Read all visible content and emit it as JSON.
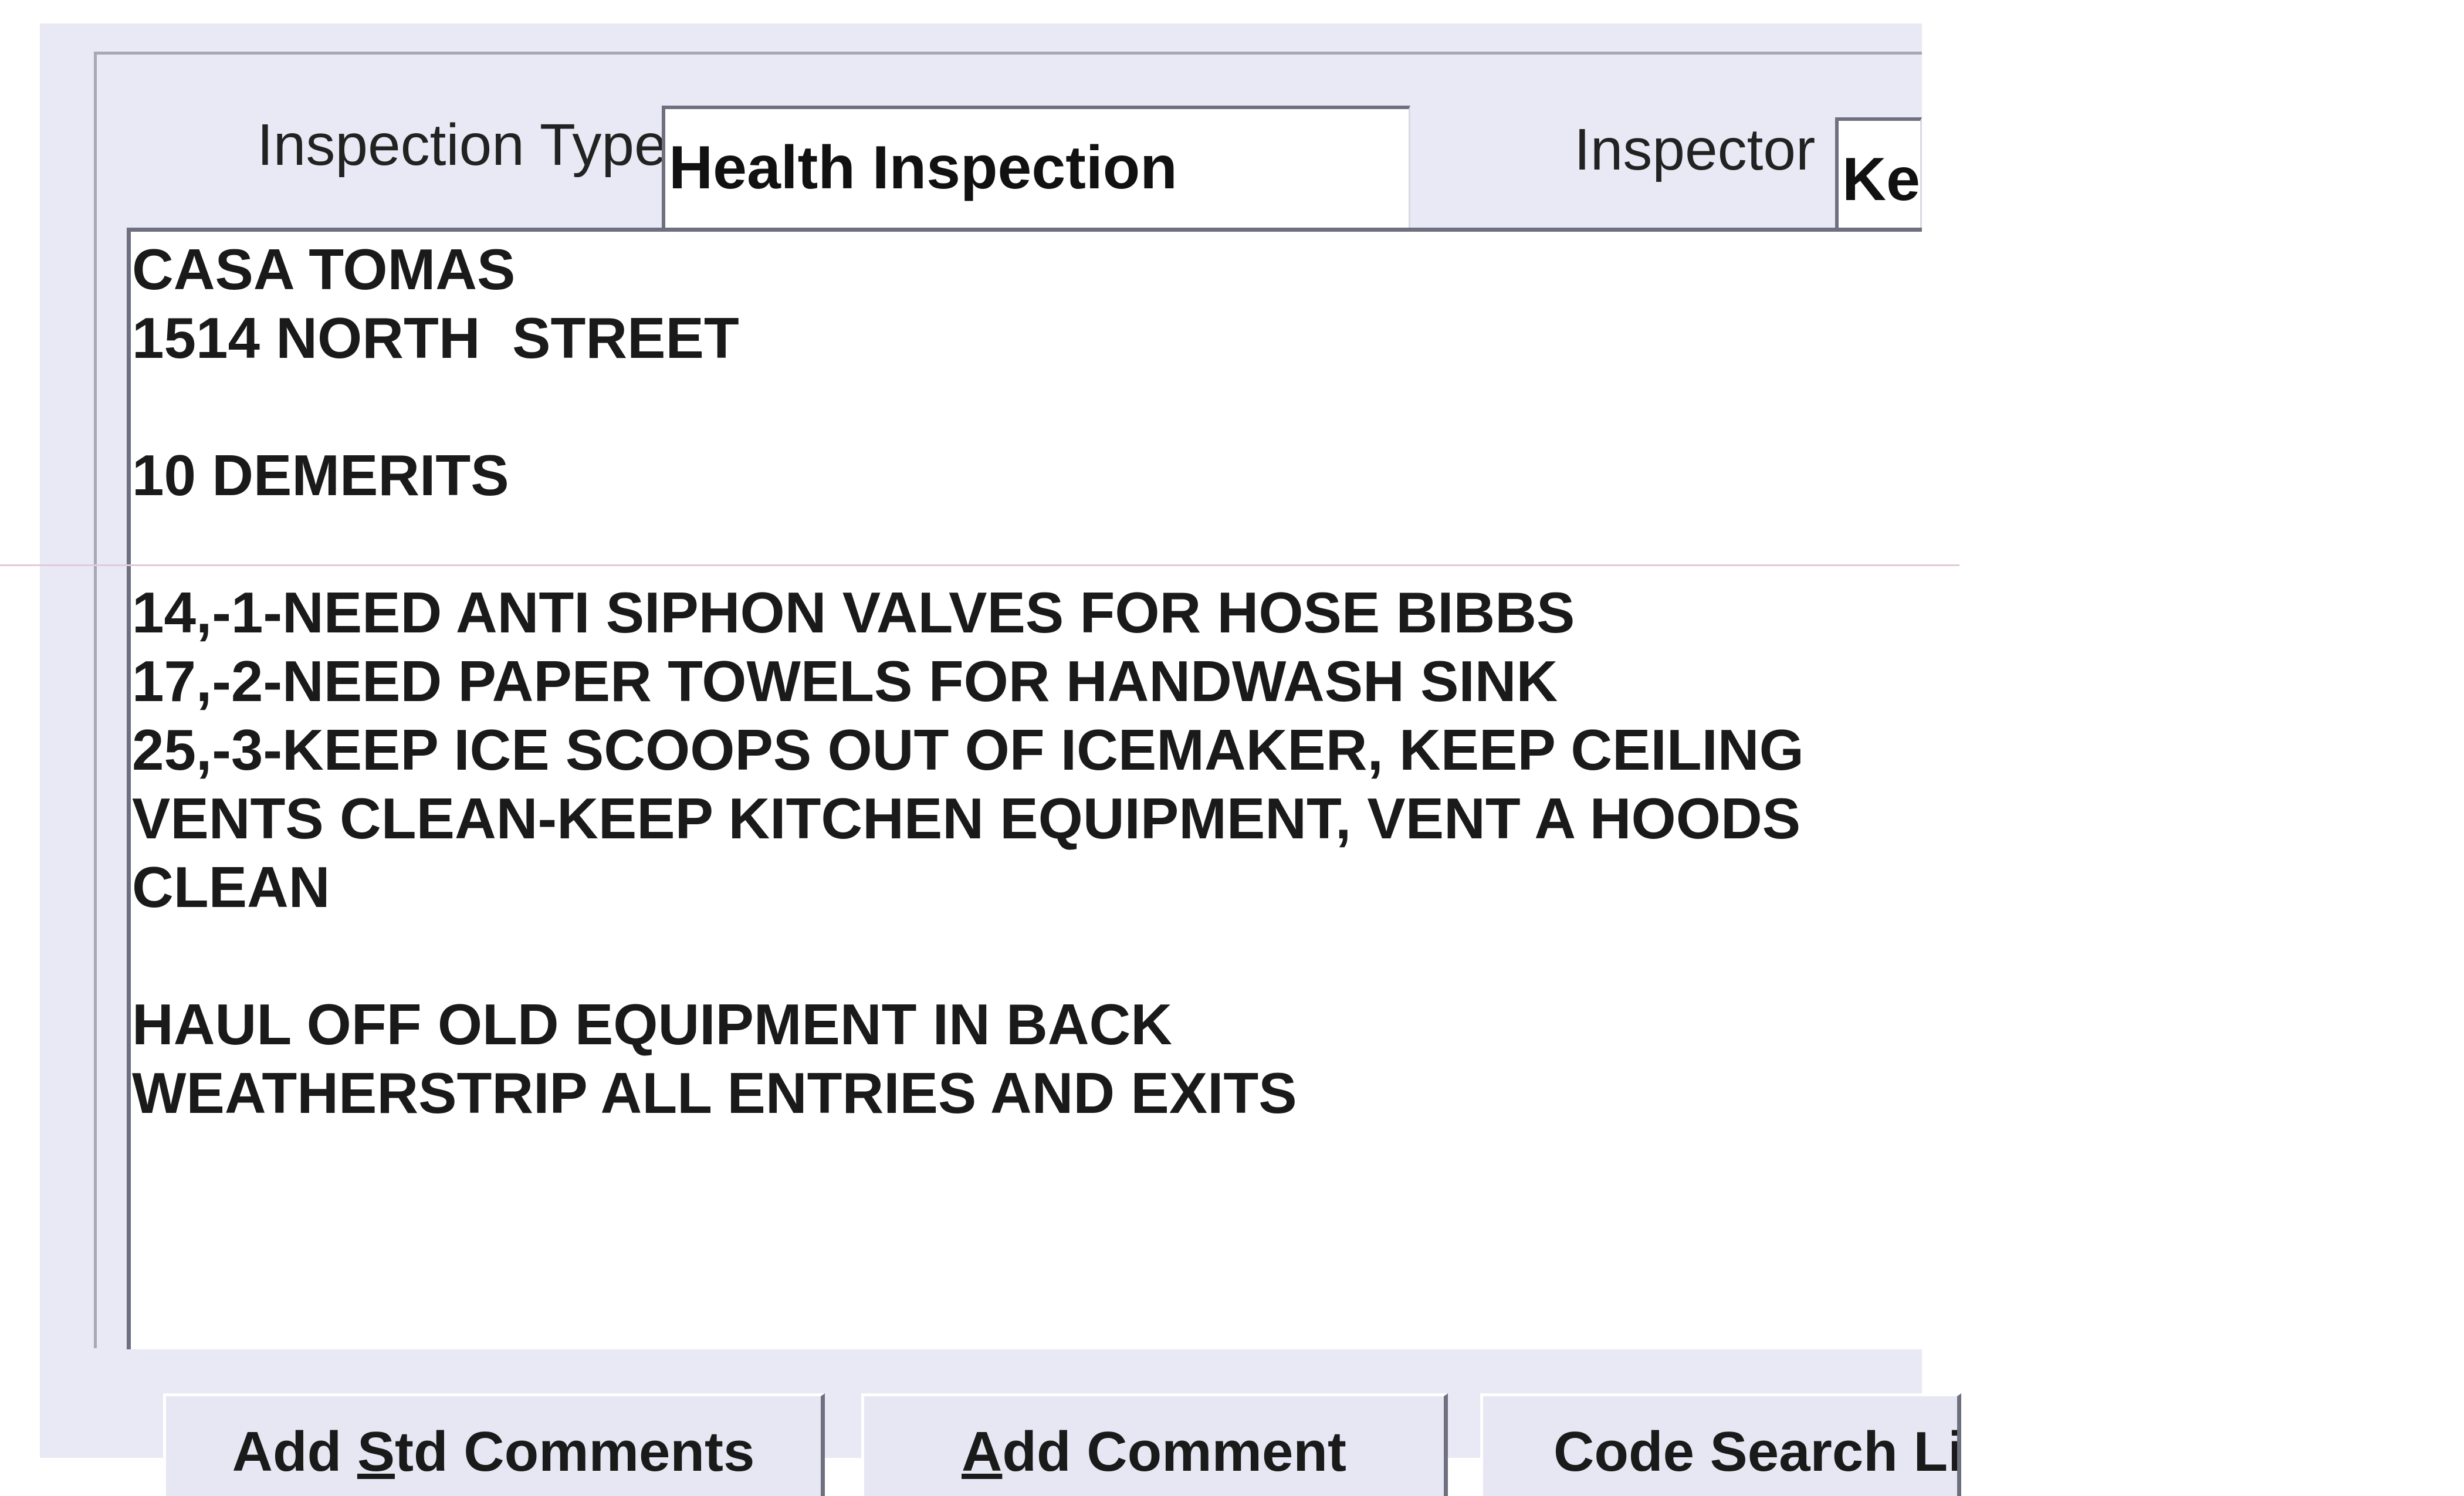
{
  "form": {
    "inspection_type_label": "Inspection Type",
    "inspection_type_value": "Health Inspection",
    "inspector_label": "Inspector",
    "inspector_value": "Ke"
  },
  "comments": {
    "text": "CASA TOMAS\n1514 NORTH  STREET\n\n10 DEMERITS\n\n14,-1-NEED ANTI SIPHON VALVES FOR HOSE BIBBS\n17,-2-NEED PAPER TOWELS FOR HANDWASH SINK\n25,-3-KEEP ICE SCOOPS OUT OF ICEMAKER, KEEP CEILING\nVENTS CLEAN-KEEP KITCHEN EQUIPMENT, VENT A HOODS\nCLEAN\n\nHAUL OFF OLD EQUIPMENT IN BACK\nWEATHERSTRIP ALL ENTRIES AND EXITS"
  },
  "buttons": {
    "add_std_comments": {
      "pre": "Add ",
      "accel": "S",
      "post": "td Comments"
    },
    "add_comment": {
      "pre": "",
      "accel": "A",
      "post": "dd Comment"
    },
    "code_search": {
      "label": "Code Search Li"
    }
  }
}
